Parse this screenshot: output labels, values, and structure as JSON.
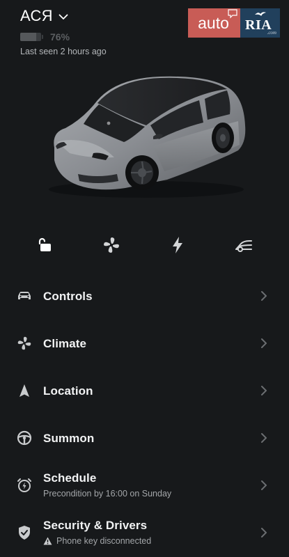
{
  "vehicle": {
    "name": "АСЯ",
    "battery_percent": 76,
    "battery_label": "76%",
    "last_seen": "Last seen 2 hours ago"
  },
  "watermark": {
    "left": "auto",
    "right": "RIA",
    "suffix": ".com"
  },
  "quick_actions": [
    {
      "name": "unlock-icon",
      "label": "Unlock"
    },
    {
      "name": "fan-icon",
      "label": "Climate"
    },
    {
      "name": "charge-bolt-icon",
      "label": "Charge"
    },
    {
      "name": "frunk-icon",
      "label": "Frunk"
    }
  ],
  "menu": {
    "controls": {
      "label": "Controls"
    },
    "climate": {
      "label": "Climate"
    },
    "location": {
      "label": "Location"
    },
    "summon": {
      "label": "Summon"
    },
    "schedule": {
      "label": "Schedule",
      "subtitle": "Precondition by 16:00 on Sunday"
    },
    "security": {
      "label": "Security & Drivers",
      "subtitle": "Phone key disconnected"
    }
  },
  "colors": {
    "background": "#17191b",
    "text": "#ffffff",
    "muted": "#a3a6a9",
    "watermark_red": "#c85c56",
    "watermark_blue": "#21405c"
  }
}
